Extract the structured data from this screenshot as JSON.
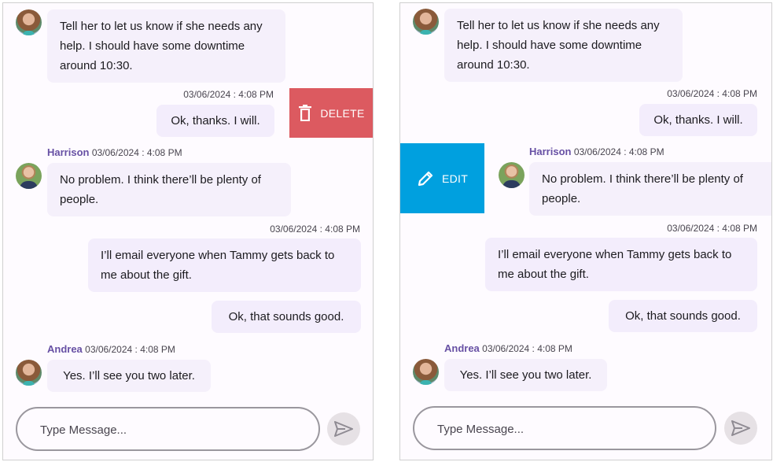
{
  "panels": [
    {
      "id": "left",
      "swipe_action": {
        "label": "DELETE",
        "icon": "trash-icon",
        "color": "#dc5a60"
      },
      "messages": [
        {
          "direction": "incoming",
          "author": "",
          "timestamp": "",
          "avatar": "andrea",
          "text": "Tell her to let us know if she needs any help. I should have some downtime around 10:30."
        },
        {
          "direction": "outgoing",
          "timestamp": "03/06/2024 : 4:08 PM",
          "text": "Ok, thanks. I will."
        },
        {
          "direction": "incoming",
          "author": "Harrison",
          "timestamp": "03/06/2024 : 4:08 PM",
          "avatar": "harrison",
          "text": "No problem. I think there’ll be plenty of people."
        },
        {
          "direction": "outgoing",
          "timestamp": "03/06/2024 : 4:08 PM",
          "text": "I’ll email everyone when Tammy gets back to me about the gift."
        },
        {
          "direction": "outgoing",
          "timestamp": "",
          "text": "Ok, that sounds good."
        },
        {
          "direction": "incoming",
          "author": "Andrea",
          "timestamp": "03/06/2024 : 4:08 PM",
          "avatar": "andrea",
          "text": "Yes. I’ll see you two later."
        }
      ],
      "composer": {
        "placeholder": "Type Message..."
      }
    },
    {
      "id": "right",
      "swipe_action": {
        "label": "EDIT",
        "icon": "pencil-icon",
        "color": "#00a0df"
      },
      "messages": [
        {
          "direction": "incoming",
          "author": "",
          "timestamp": "",
          "avatar": "andrea",
          "text": "Tell her to let us know if she needs any help. I should have some downtime around 10:30."
        },
        {
          "direction": "outgoing",
          "timestamp": "03/06/2024 : 4:08 PM",
          "text": "Ok, thanks. I will."
        },
        {
          "direction": "incoming",
          "author": "Harrison",
          "timestamp": "03/06/2024 : 4:08 PM",
          "avatar": "harrison",
          "text": "No problem. I think there’ll be plenty of people."
        },
        {
          "direction": "outgoing",
          "timestamp": "03/06/2024 : 4:08 PM",
          "text": "I’ll email everyone when Tammy gets back to me about the gift."
        },
        {
          "direction": "outgoing",
          "timestamp": "",
          "text": "Ok, that sounds good."
        },
        {
          "direction": "incoming",
          "author": "Andrea",
          "timestamp": "03/06/2024 : 4:08 PM",
          "avatar": "andrea",
          "text": "Yes. I’ll see you two later."
        }
      ],
      "composer": {
        "placeholder": "Type Message..."
      }
    }
  ],
  "colors": {
    "author": "#6750a4",
    "bubble": "#f5f0fb",
    "background": "#fefbff"
  }
}
